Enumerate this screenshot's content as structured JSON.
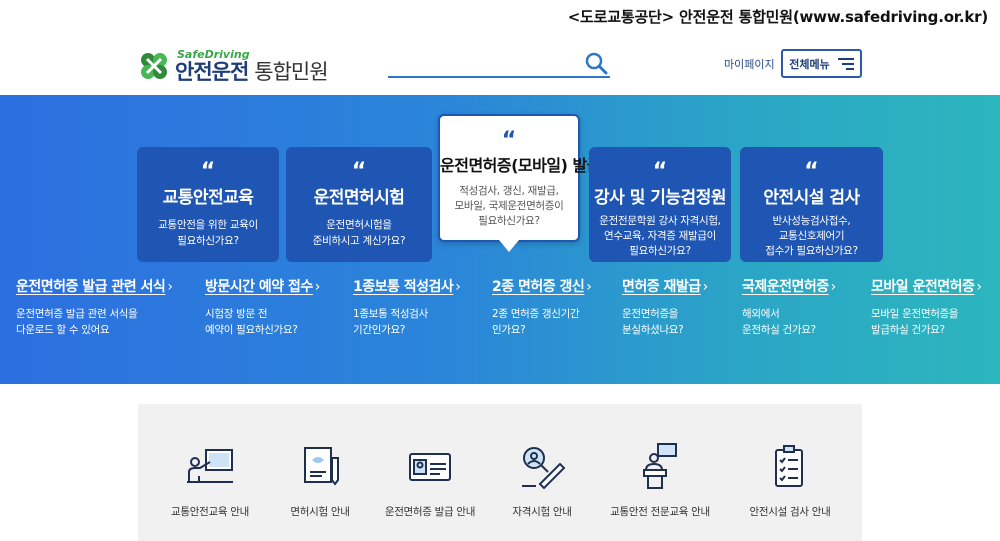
{
  "caption": "<도로교통공단> 안전운전 통합민원(www.safedriving.or.kr)",
  "header": {
    "logo_sub": "SafeDriving",
    "logo_main": "안전운전",
    "logo_light": "통합민원",
    "search_placeholder": "",
    "mypage": "마이페이지",
    "allmenu": "전체메뉴"
  },
  "cards": [
    {
      "title": "교통안전교육",
      "desc1": "교통안전을 위한 교육이",
      "desc2": "필요하신가요?"
    },
    {
      "title": "운전면허시험",
      "desc1": "운전면허시험을",
      "desc2": "준비하시고 계신가요?"
    },
    {
      "title": "운전면허증(모바일) 발급",
      "desc1": "적성검사, 갱신, 재발급,",
      "desc2": "모바일, 국제운전면허증이",
      "desc3": "필요하신가요?"
    },
    {
      "title": "강사 및 기능검정원",
      "desc1": "운전전문학원 강사 자격시험,",
      "desc2": "연수교육, 자격증 재발급이",
      "desc3": "필요하신가요?"
    },
    {
      "title": "안전시설 검사",
      "desc1": "반사성능검사접수,",
      "desc2": "교통신호제어기",
      "desc3": "접수가 필요하신가요?"
    }
  ],
  "links": [
    {
      "title": "운전면허증 발급 관련 서식",
      "desc1": "운전면허증 발급 관련 서식을",
      "desc2": "다운로드 할 수 있어요"
    },
    {
      "title": "방문시간 예약 접수",
      "desc1": "시험장 방문 전",
      "desc2": "예약이 필요하신가요?"
    },
    {
      "title": "1종보통 적성검사",
      "desc1": "1종보통 적성검사",
      "desc2": "기간인가요?"
    },
    {
      "title": "2종 면허증 갱신",
      "desc1": "2종 면허증 갱신기간",
      "desc2": "인가요?"
    },
    {
      "title": "면허증 재발급",
      "desc1": "운전면허증을",
      "desc2": "분실하셨나요?"
    },
    {
      "title": "국제운전면허증",
      "desc1": "해외에서",
      "desc2": "운전하실 건가요?"
    },
    {
      "title": "모바일 운전면허증",
      "desc1": "모바일 운전면허증을",
      "desc2": "발급하실 건가요?"
    }
  ],
  "quick": [
    {
      "label": "교통안전교육 안내",
      "icon": "lecture-board-icon"
    },
    {
      "label": "면허시험 안내",
      "icon": "exam-document-icon"
    },
    {
      "label": "운전면허증 발급 안내",
      "icon": "id-card-icon"
    },
    {
      "label": "자격시험 안내",
      "icon": "qualification-exam-icon"
    },
    {
      "label": "교통안전 전문교육 안내",
      "icon": "podium-speaker-icon"
    },
    {
      "label": "안전시설 검사 안내",
      "icon": "checklist-icon"
    }
  ],
  "colors": {
    "brand_navy": "#1d3e7a",
    "card_blue": "#1f55b3",
    "logo_green": "#3aa64a"
  }
}
